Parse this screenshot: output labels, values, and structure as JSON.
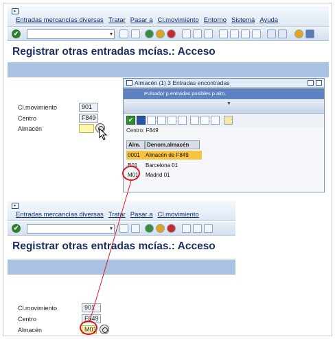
{
  "menu": {
    "items": [
      "Entradas mercancías diversas",
      "Tratar",
      "Pasar a",
      "Cl.movimiento",
      "Entorno",
      "Sistema",
      "Ayuda"
    ],
    "items_short": [
      "Entradas mercancías diversas",
      "Tratar",
      "Pasar a",
      "Cl.movimiento"
    ]
  },
  "toolbar": {
    "ok_icon": "checkmark-icon",
    "command_field": "",
    "dropdown_arrow": "▾"
  },
  "page": {
    "title": "Registrar otras entradas mcías.: Acceso"
  },
  "form_top": {
    "clmov_label": "Cl.movimiento",
    "clmov_value": "901",
    "centro_label": "Centro",
    "centro_value": "F849",
    "almacen_label": "Almacén",
    "almacen_value": ""
  },
  "form_bottom": {
    "clmov_label": "Cl.movimiento",
    "clmov_value": "901",
    "centro_label": "Centro",
    "centro_value": "F849",
    "almacen_label": "Almacén",
    "almacen_value": "M01"
  },
  "popup": {
    "title": "Almacén (1)   3 Entradas encontradas",
    "pulsador": "Pulsador p.entradas posibles p.alm.",
    "centro_line": "Centro: F849",
    "columns": [
      "Alm.",
      "Denom.almacén"
    ],
    "rows": [
      {
        "code": "0001",
        "name": "Almacén de F849",
        "highlighted": true
      },
      {
        "code": "B01",
        "name": "Barcelona 01",
        "highlighted": false
      },
      {
        "code": "M01",
        "name": "Madrid 01",
        "highlighted": false
      }
    ]
  },
  "colors": {
    "title": "#1b2f5e",
    "bluebar": "#a9c1e3",
    "highlight": "#f7c342",
    "annotation": "#d91a1a"
  }
}
